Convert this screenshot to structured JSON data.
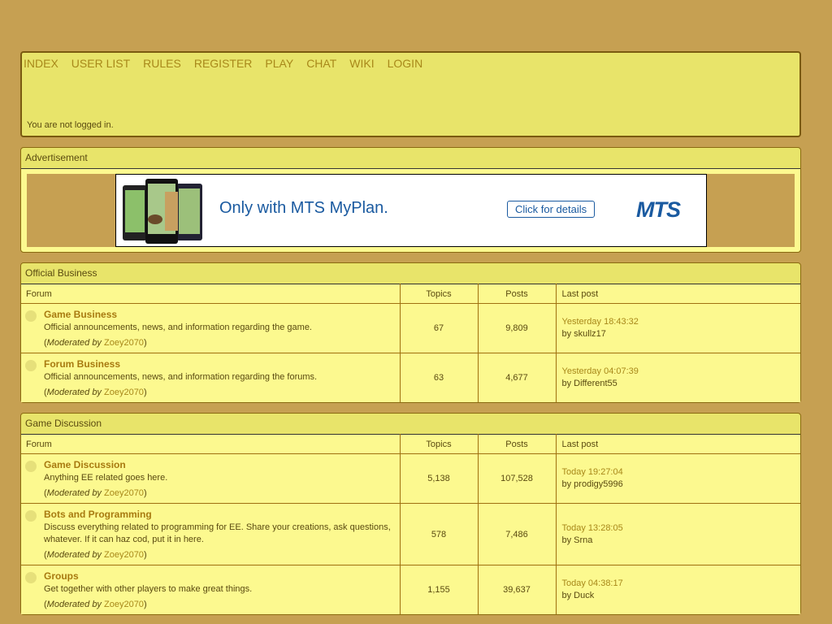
{
  "nav": {
    "items": [
      "INDEX",
      "USER LIST",
      "RULES",
      "REGISTER",
      "PLAY",
      "CHAT",
      "WIKI",
      "LOGIN"
    ],
    "status": "You are not logged in."
  },
  "ad": {
    "title": "Advertisement",
    "text": "Only with MTS MyPlan.",
    "button": "Click for details",
    "logo": "MTS"
  },
  "columns": {
    "forum": "Forum",
    "topics": "Topics",
    "posts": "Posts",
    "last": "Last post"
  },
  "categories": [
    {
      "title": "Official Business",
      "forums": [
        {
          "name": "Game Business",
          "desc": "Official announcements, news, and information regarding the game.",
          "mod_label": "Moderated by",
          "mod": "Zoey2070",
          "topics": "67",
          "posts": "9,809",
          "last_time": "Yesterday 18:43:32",
          "last_by": "by skullz17"
        },
        {
          "name": "Forum Business",
          "desc": "Official announcements, news, and information regarding the forums.",
          "mod_label": "Moderated by",
          "mod": "Zoey2070",
          "topics": "63",
          "posts": "4,677",
          "last_time": "Yesterday 04:07:39",
          "last_by": "by Different55"
        }
      ]
    },
    {
      "title": "Game Discussion",
      "forums": [
        {
          "name": "Game Discussion",
          "desc": "Anything EE related goes here.",
          "mod_label": "Moderated by",
          "mod": "Zoey2070",
          "topics": "5,138",
          "posts": "107,528",
          "last_time": "Today 19:27:04",
          "last_by": "by prodigy5996"
        },
        {
          "name": "Bots and Programming",
          "desc": "Discuss everything related to programming for EE. Share your creations, ask questions, whatever. If it can haz cod, put it in here.",
          "mod_label": "Moderated by",
          "mod": "Zoey2070",
          "topics": "578",
          "posts": "7,486",
          "last_time": "Today 13:28:05",
          "last_by": "by Srna"
        },
        {
          "name": "Groups",
          "desc": "Get together with other players to make great things.",
          "mod_label": "Moderated by",
          "mod": "Zoey2070",
          "topics": "1,155",
          "posts": "39,637",
          "last_time": "Today 04:38:17",
          "last_by": "by Duck"
        }
      ]
    }
  ]
}
